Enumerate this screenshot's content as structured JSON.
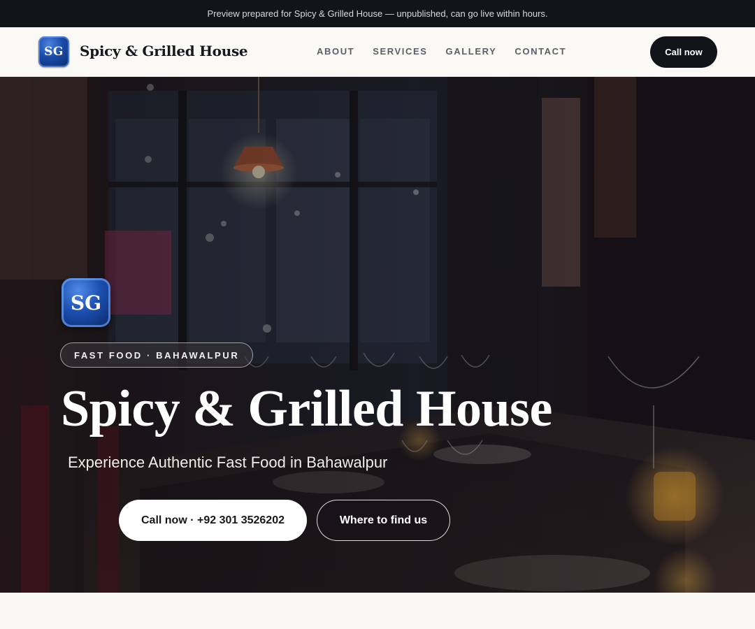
{
  "preview_banner": "Preview prepared for Spicy & Grilled House — unpublished, can go live within hours.",
  "nav": {
    "logo_text": "SG",
    "brand": "Spicy & Grilled House",
    "links": [
      "ABOUT",
      "SERVICES",
      "GALLERY",
      "CONTACT"
    ],
    "cta": "Call now"
  },
  "hero": {
    "logo_text": "SG",
    "tag": "FAST FOOD · BAHAWALPUR",
    "title": "Spicy & Grilled House",
    "subtitle": "Experience Authentic Fast Food in Bahawalpur",
    "primary_button": "Call now · +92 301 3526202",
    "secondary_button": "Where to find us"
  },
  "colors": {
    "dark": "#121419",
    "logo_blue": "#1a4aa8",
    "page_bg": "#faf8f4"
  }
}
